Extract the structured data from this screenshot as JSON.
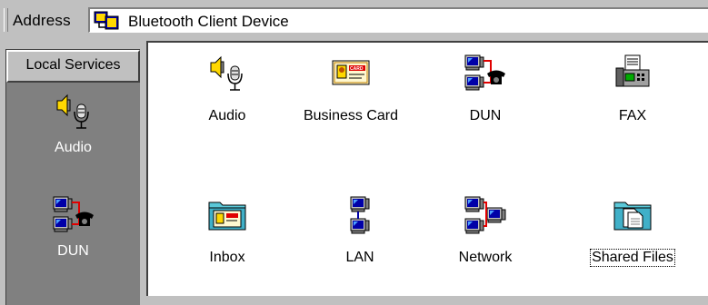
{
  "address_bar": {
    "label": "Address",
    "value": "Bluetooth Client Device"
  },
  "left_pane": {
    "header": "Local Services",
    "items": [
      {
        "label": "Audio",
        "icon": "audio-icon"
      },
      {
        "label": "DUN",
        "icon": "dun-icon"
      }
    ]
  },
  "main": {
    "items": [
      {
        "label": "Audio",
        "icon": "audio-icon"
      },
      {
        "label": "Business Card",
        "icon": "business-card-icon"
      },
      {
        "label": "DUN",
        "icon": "dun-icon"
      },
      {
        "label": "FAX",
        "icon": "fax-icon"
      },
      {
        "label": "Inbox",
        "icon": "inbox-folder-icon"
      },
      {
        "label": "LAN",
        "icon": "lan-icon"
      },
      {
        "label": "Network",
        "icon": "network-icon"
      },
      {
        "label": "Shared Files",
        "icon": "shared-files-folder-icon"
      }
    ]
  },
  "colors": {
    "chrome": "#c0c0c0",
    "left_pane_bg": "#808080",
    "screen_blue": "#0000a8",
    "link_red": "#e00000"
  }
}
